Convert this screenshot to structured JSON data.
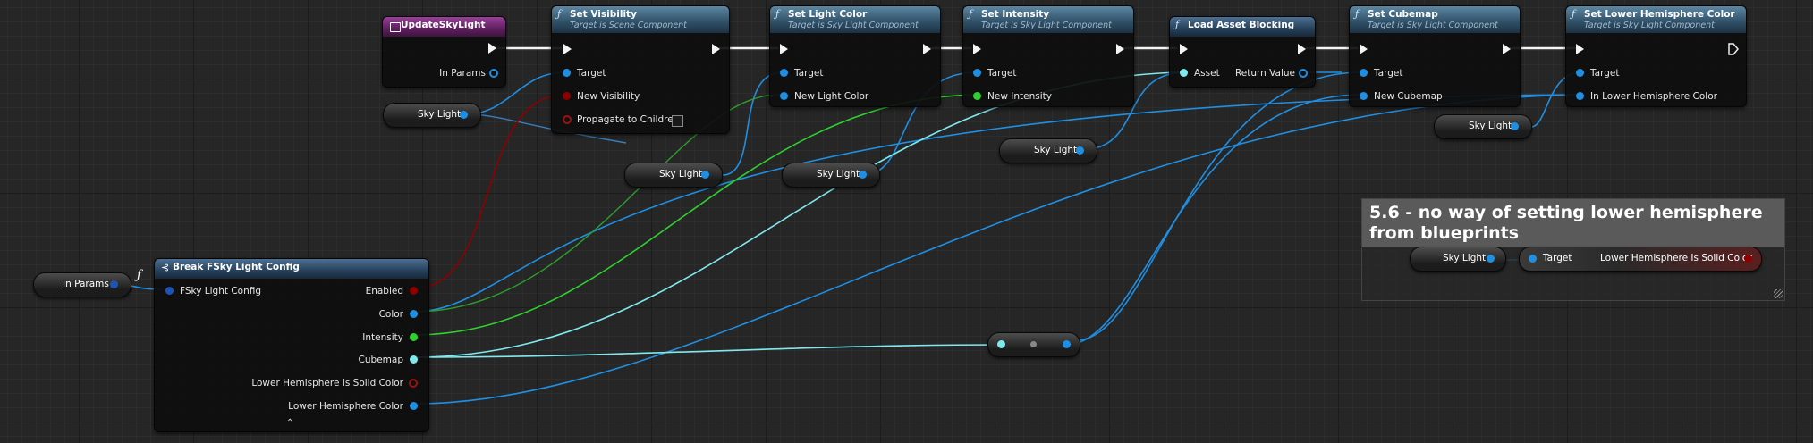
{
  "nodes": {
    "update_sky_light": {
      "title": "UpdateSkyLight",
      "in_params": "In Params"
    },
    "set_visibility": {
      "title": "Set Visibility",
      "subtitle": "Target is Scene Component",
      "target": "Target",
      "new_visibility": "New Visibility",
      "propagate": "Propagate to Children"
    },
    "set_light_color": {
      "title": "Set Light Color",
      "subtitle": "Target is Sky Light Component",
      "target": "Target",
      "new_light_color": "New Light Color"
    },
    "set_intensity": {
      "title": "Set Intensity",
      "subtitle": "Target is Sky Light Component",
      "target": "Target",
      "new_intensity": "New Intensity"
    },
    "load_asset_blocking": {
      "title": "Load Asset Blocking",
      "asset": "Asset",
      "return_value": "Return Value"
    },
    "set_cubemap": {
      "title": "Set Cubemap",
      "subtitle": "Target is Sky Light Component",
      "target": "Target",
      "new_cubemap": "New Cubemap"
    },
    "set_lower_hemisphere": {
      "title": "Set Lower Hemisphere Color",
      "subtitle": "Target is Sky Light Component",
      "target": "Target",
      "in_color": "In Lower Hemisphere Color"
    },
    "break_config": {
      "title": "Break FSky Light Config",
      "input": "FSky Light Config",
      "outputs": [
        "Enabled",
        "Color",
        "Intensity",
        "Cubemap",
        "Lower Hemisphere Is Solid Color",
        "Lower Hemisphere Color"
      ]
    },
    "in_params_var": "In Params",
    "sky_light_var": "Sky Light",
    "comment": {
      "title": "5.6 - no way of setting lower hemisphere from blueprints",
      "target": "Target",
      "solid_color": "Lower Hemisphere Is Solid Color"
    }
  },
  "colors": {
    "object_pin": "#1f8fe3",
    "bool_pin": "#8e0000",
    "linear_color_pin": "#2ed12e",
    "cubemap_pin": "#7fe9ef",
    "exec_wire": "#f4f4f4"
  },
  "icons": [
    "function-icon",
    "event-icon",
    "struct-break-icon",
    "expand-arrow-icon"
  ]
}
